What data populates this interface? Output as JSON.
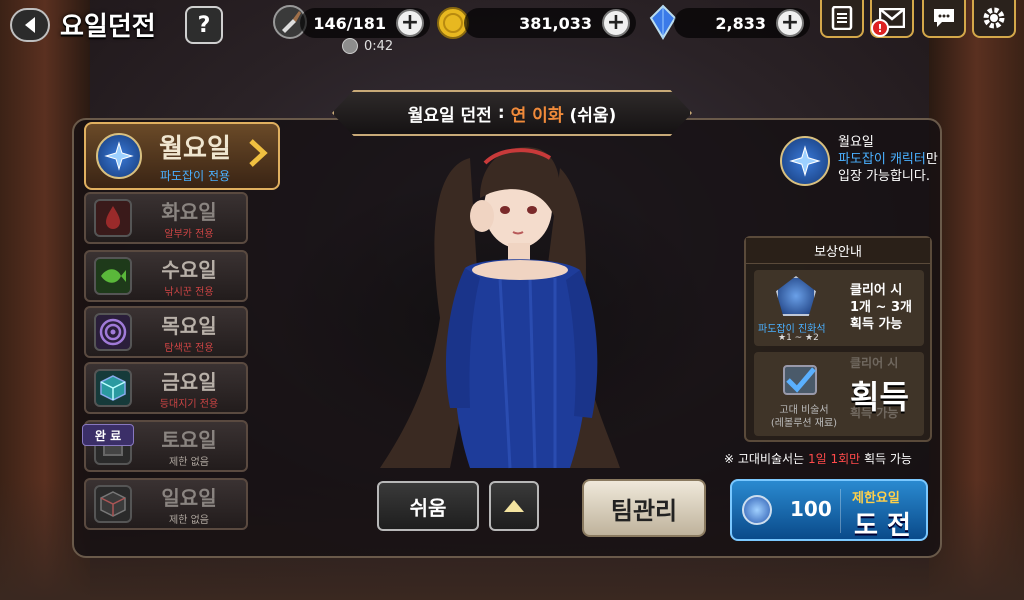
{
  "header": {
    "title": "요일던전",
    "help_label": "?"
  },
  "resources": {
    "stamina": "146/181",
    "timer": "0:42",
    "gold": "381,033",
    "gems": "2,833",
    "plus": "+"
  },
  "alerts": {
    "mail_badge": "!"
  },
  "dungeon_banner": {
    "day": "월요일 던전",
    "separator": ":",
    "boss": "연 이화",
    "difficulty": "(쉬움)"
  },
  "days": [
    {
      "name": "월요일",
      "sub": "파도잡이 전용"
    },
    {
      "name": "화요일",
      "sub": "알부카 전용"
    },
    {
      "name": "수요일",
      "sub": "낚시꾼 전용"
    },
    {
      "name": "목요일",
      "sub": "탐색꾼 전용"
    },
    {
      "name": "금요일",
      "sub": "등대지기 전용"
    },
    {
      "name": "토요일",
      "sub": "제한 없음"
    },
    {
      "name": "일요일",
      "sub": "제한 없음"
    }
  ],
  "done_tag": "완 료",
  "info": {
    "day": "월요일",
    "class": "파도잡이 캐릭터",
    "suffix": "만",
    "line2": "입장 가능합니다."
  },
  "reward": {
    "head": "보상안내",
    "item1_name": "파도잡이 진화석",
    "item1_stars": "★1 ~ ★2",
    "item1_clear_line1": "클리어 시",
    "item1_clear_line2": "1개 ~ 3개",
    "item1_clear_line3": "획득 가능",
    "item2_name_line1": "고대 비술서",
    "item2_name_line2": "(레볼루션 재료)",
    "item2_faded_line1": "클리어 시",
    "item2_faded_line2": "획득 가능",
    "item2_status": "획득"
  },
  "note": {
    "prefix": "※ 고대비술서는",
    "highlight": "1일 1회만",
    "suffix": "획득 가능"
  },
  "buttons": {
    "difficulty": "쉬움",
    "team": "팀관리",
    "challenge_cost": "100",
    "challenge_top": "제한요일",
    "challenge_main": "도 전"
  },
  "colors": {
    "accent_blue": "#4ab0ff",
    "accent_orange": "#f08a3a",
    "alert_red": "#ff4a4a"
  }
}
